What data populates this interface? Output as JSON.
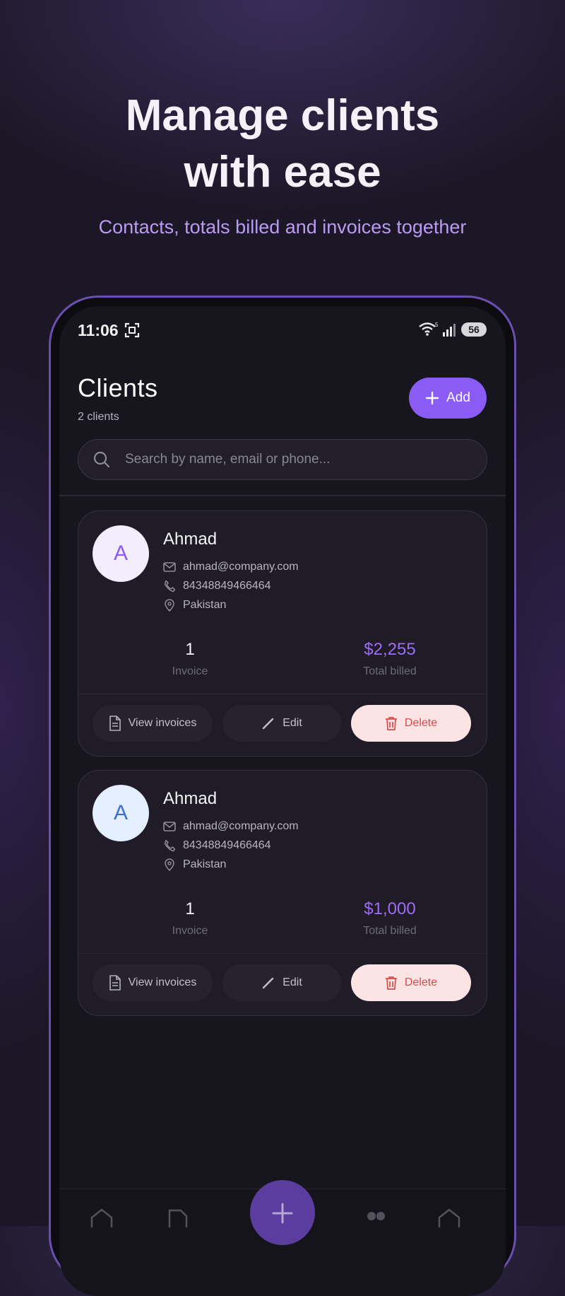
{
  "hero": {
    "title_line1": "Manage clients",
    "title_line2": "with ease",
    "subtitle": "Contacts, totals billed and invoices together"
  },
  "status_bar": {
    "time": "11:06",
    "battery": "56",
    "icons": [
      "screenshot-icon",
      "wifi-icon",
      "signal-icon"
    ]
  },
  "header": {
    "title": "Clients",
    "count": "2 clients",
    "add_label": "Add"
  },
  "search": {
    "placeholder": "Search by name, email or phone...",
    "value": ""
  },
  "clients": [
    {
      "initial": "A",
      "name": "Ahmad",
      "email": "ahmad@company.com",
      "phone": "84348849466464",
      "location": "Pakistan",
      "invoice_count": "1",
      "invoice_label": "Invoice",
      "total_billed": "$2,255",
      "total_label": "Total billed",
      "avatar_bg": "#f3eefe",
      "avatar_fg": "#8a5cf5"
    },
    {
      "initial": "A",
      "name": "Ahmad",
      "email": "ahmad@company.com",
      "phone": "84348849466464",
      "location": "Pakistan",
      "invoice_count": "1",
      "invoice_label": "Invoice",
      "total_billed": "$1,000",
      "total_label": "Total billed",
      "avatar_bg": "#e4efff",
      "avatar_fg": "#3e6fd8"
    }
  ],
  "actions": {
    "view_label": "View invoices",
    "edit_label": "Edit",
    "delete_label": "Delete"
  },
  "colors": {
    "accent": "#8a5cf5",
    "delete_bg": "#fde4e4",
    "delete_text": "#d94a4a",
    "background": "#1b1726"
  }
}
